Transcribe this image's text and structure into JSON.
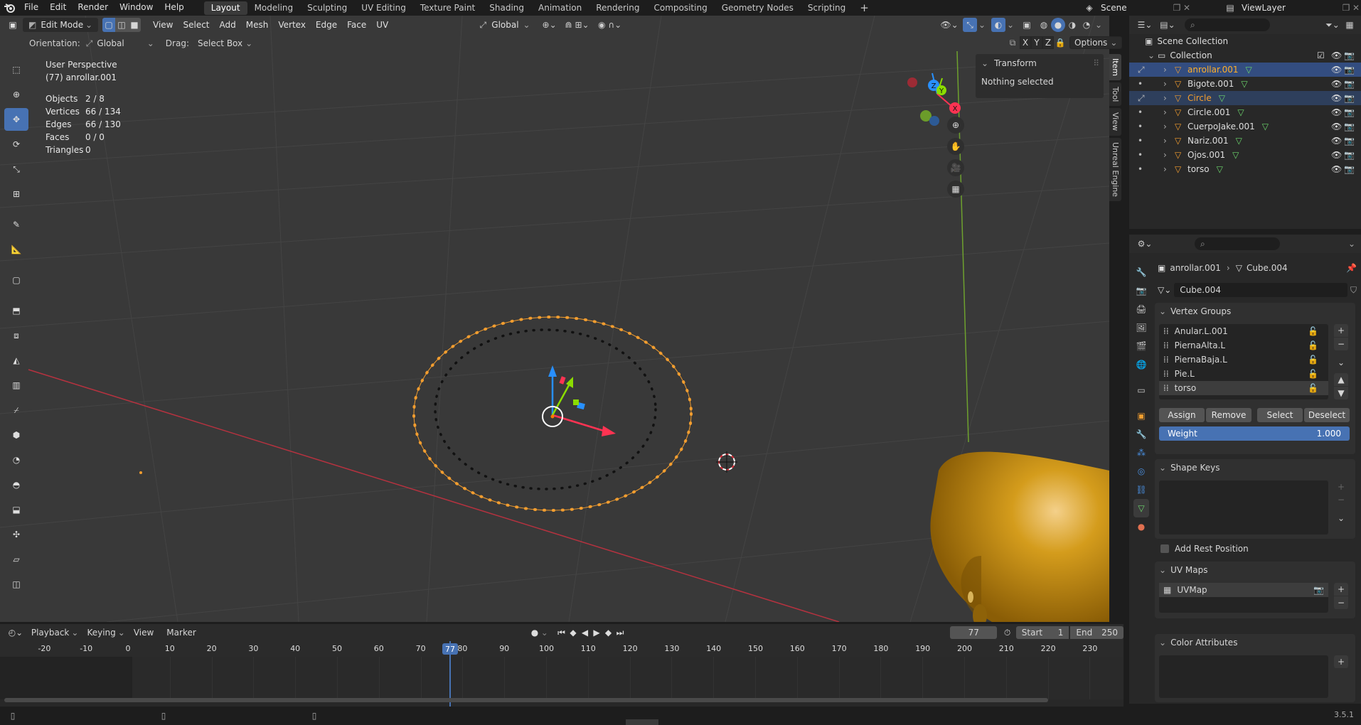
{
  "app": {
    "version": "3.5.1"
  },
  "menu": [
    "File",
    "Edit",
    "Render",
    "Window",
    "Help"
  ],
  "workspaces": [
    {
      "label": "Layout",
      "active": true
    },
    {
      "label": "Modeling"
    },
    {
      "label": "Sculpting"
    },
    {
      "label": "UV Editing"
    },
    {
      "label": "Texture Paint"
    },
    {
      "label": "Shading"
    },
    {
      "label": "Animation"
    },
    {
      "label": "Rendering"
    },
    {
      "label": "Compositing"
    },
    {
      "label": "Geometry Nodes"
    },
    {
      "label": "Scripting"
    }
  ],
  "scene": {
    "name": "Scene",
    "view_layer": "ViewLayer"
  },
  "viewport_header": {
    "mode": "Edit Mode",
    "menus": [
      "View",
      "Select",
      "Add",
      "Mesh",
      "Vertex",
      "Edge",
      "Face",
      "UV"
    ],
    "transform_orientation": "Global",
    "axes": [
      "X",
      "Y",
      "Z"
    ],
    "options_label": "Options"
  },
  "tool_settings": {
    "orientation_label": "Orientation:",
    "orientation_value": "Global",
    "drag_label": "Drag:",
    "drag_value": "Select Box"
  },
  "viewport_overlay": {
    "perspective": "User Perspective",
    "object_info": "(77) anrollar.001",
    "stats": [
      {
        "label": "Objects",
        "value": "2 / 8"
      },
      {
        "label": "Vertices",
        "value": "66 / 134"
      },
      {
        "label": "Edges",
        "value": "66 / 130"
      },
      {
        "label": "Faces",
        "value": "0 / 0"
      },
      {
        "label": "Triangles",
        "value": "0"
      }
    ]
  },
  "npanel": {
    "title": "Transform",
    "message": "Nothing selected",
    "tabs": [
      "Item",
      "Tool",
      "View",
      "Unreal Engine"
    ]
  },
  "outliner": {
    "root": "Scene Collection",
    "collection": "Collection",
    "items": [
      {
        "name": "anrollar.001",
        "state": "active"
      },
      {
        "name": "Bigote.001",
        "state": "normal"
      },
      {
        "name": "Circle",
        "state": "selected"
      },
      {
        "name": "Circle.001",
        "state": "normal"
      },
      {
        "name": "CuerpoJake.001",
        "state": "normal"
      },
      {
        "name": "Nariz.001",
        "state": "normal"
      },
      {
        "name": "Ojos.001",
        "state": "normal"
      },
      {
        "name": "torso",
        "state": "normal"
      }
    ]
  },
  "properties": {
    "breadcrumb_object": "anrollar.001",
    "breadcrumb_data": "Cube.004",
    "mesh_name": "Cube.004",
    "vertex_groups_title": "Vertex Groups",
    "vertex_groups": [
      "Anular.L.001",
      "PiernaAlta.L",
      "PiernaBaja.L",
      "Pie.L",
      "torso"
    ],
    "vg_buttons": [
      "Assign",
      "Remove",
      "Select",
      "Deselect"
    ],
    "weight_label": "Weight",
    "weight_value": "1.000",
    "shape_keys_title": "Shape Keys",
    "add_rest_position": "Add Rest Position",
    "uv_maps_title": "UV Maps",
    "uv_map": "UVMap",
    "color_attributes_title": "Color Attributes"
  },
  "timeline": {
    "menus": [
      "Playback",
      "Keying",
      "View",
      "Marker"
    ],
    "current_frame": "77",
    "start_label": "Start",
    "start": "1",
    "end_label": "End",
    "end": "250",
    "ticks": [
      "-20",
      "-10",
      "0",
      "10",
      "20",
      "30",
      "40",
      "50",
      "60",
      "70",
      "80",
      "90",
      "100",
      "110",
      "120",
      "130",
      "140",
      "150",
      "160",
      "170",
      "180",
      "190",
      "200",
      "210",
      "220",
      "230"
    ]
  },
  "colors": {
    "accent": "#4772b3",
    "selection_orange": "#f29d2f",
    "active_object_text": "#ffaf29",
    "x_axis": "#ff3352",
    "y_axis": "#8bdc00",
    "z_axis": "#2890ff"
  }
}
